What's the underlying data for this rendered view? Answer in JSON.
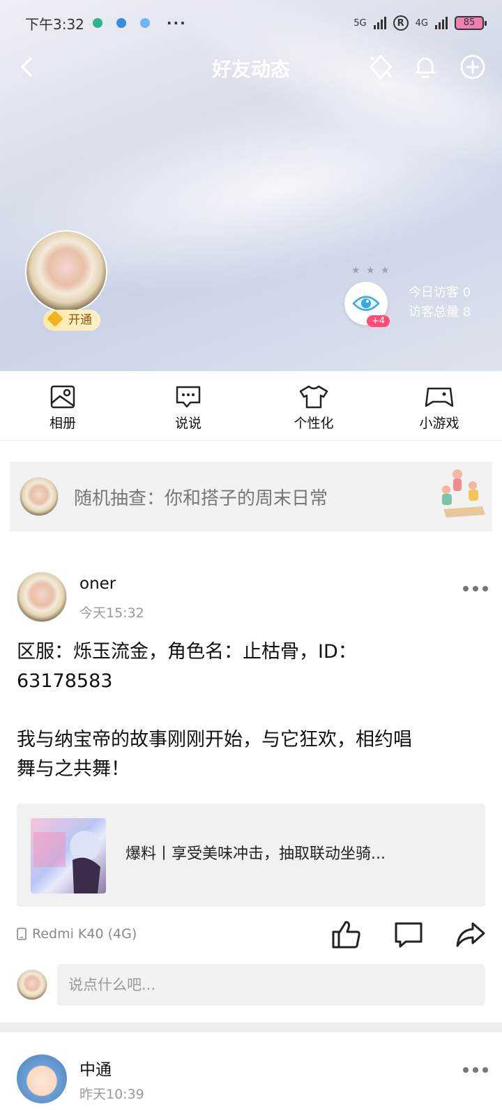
{
  "status_bar": {
    "time": "下午3:32",
    "net_label_1": "5G",
    "net_label_2": "4G",
    "battery": "85",
    "more": "···"
  },
  "nav": {
    "title": "好友动态"
  },
  "profile": {
    "vip_label": "开通",
    "visitor_badge": "+4",
    "today_visitors": "今日访客 0",
    "total_visitors": "访客总量 8"
  },
  "tabs": [
    {
      "label": "相册",
      "icon": "photo-album-icon"
    },
    {
      "label": "说说",
      "icon": "chat-bubble-icon"
    },
    {
      "label": "个性化",
      "icon": "tshirt-icon"
    },
    {
      "label": "小游戏",
      "icon": "gamepad-icon"
    }
  ],
  "banner": {
    "text": "随机抽查：你和搭子的周末日常"
  },
  "post": {
    "name": "oner",
    "time": "今天15:32",
    "body": "区服：烁玉流金，角色名：止枯骨，ID：\n63178583\n\n我与纳宝帝的故事刚刚开始，与它狂欢，相约唱\n舞与之共舞！",
    "link_title": "爆料丨享受美味冲击，抽取联动坐骑...",
    "device": "Redmi K40 (4G)",
    "comment_placeholder": "说点什么吧..."
  },
  "post2": {
    "name": "中通",
    "time": "昨天10:39"
  },
  "colors": {
    "accent": "#ff4d7a",
    "eye_blue": "#35a9e6",
    "vip_gold": "#f2b322"
  }
}
